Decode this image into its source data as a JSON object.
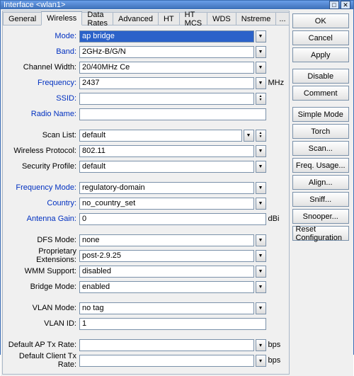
{
  "window": {
    "title": "Interface <wlan1>"
  },
  "tabs": [
    "General",
    "Wireless",
    "Data Rates",
    "Advanced",
    "HT",
    "HT MCS",
    "WDS",
    "Nstreme",
    "..."
  ],
  "active_tab": 1,
  "form": {
    "mode": {
      "label": "Mode:",
      "value": "ap bridge",
      "blue": true,
      "dd": true,
      "sel": true
    },
    "band": {
      "label": "Band:",
      "value": "2GHz-B/G/N",
      "blue": true,
      "dd": true
    },
    "chwidth": {
      "label": "Channel Width:",
      "value": "20/40MHz Ce",
      "blue": false,
      "dd": true
    },
    "freq": {
      "label": "Frequency:",
      "value": "2437",
      "blue": true,
      "dd": true,
      "unit": "MHz"
    },
    "ssid": {
      "label": "SSID:",
      "value": "",
      "blue": true,
      "updown": true
    },
    "radio": {
      "label": "Radio Name:",
      "value": "",
      "blue": true
    },
    "scanlist": {
      "label": "Scan List:",
      "value": "default",
      "blue": false,
      "dd": true,
      "updown": true
    },
    "wproto": {
      "label": "Wireless Protocol:",
      "value": "802.11",
      "blue": false,
      "dd": true
    },
    "secprof": {
      "label": "Security Profile:",
      "value": "default",
      "blue": false,
      "dd": true
    },
    "freqmode": {
      "label": "Frequency Mode:",
      "value": "regulatory-domain",
      "blue": true,
      "dd": true
    },
    "country": {
      "label": "Country:",
      "value": "no_country_set",
      "blue": true,
      "dd": true
    },
    "antgain": {
      "label": "Antenna Gain:",
      "value": "0",
      "blue": true,
      "unit": "dBi"
    },
    "dfs": {
      "label": "DFS Mode:",
      "value": "none",
      "blue": false,
      "dd": true
    },
    "propext": {
      "label": "Proprietary Extensions:",
      "value": "post-2.9.25",
      "blue": false,
      "dd": true
    },
    "wmm": {
      "label": "WMM Support:",
      "value": "disabled",
      "blue": false,
      "dd": true
    },
    "bridge": {
      "label": "Bridge Mode:",
      "value": "enabled",
      "blue": false,
      "dd": true
    },
    "vlanmode": {
      "label": "VLAN Mode:",
      "value": "no tag",
      "blue": false,
      "dd": true
    },
    "vlanid": {
      "label": "VLAN ID:",
      "value": "1",
      "blue": false
    },
    "defap": {
      "label": "Default AP Tx Rate:",
      "value": "",
      "blue": false,
      "dd_solid": true,
      "unit": "bps"
    },
    "defcl": {
      "label": "Default Client Tx Rate:",
      "value": "",
      "blue": false,
      "dd_solid": true,
      "unit": "bps"
    }
  },
  "buttons": {
    "ok": "OK",
    "cancel": "Cancel",
    "apply": "Apply",
    "disable": "Disable",
    "comment": "Comment",
    "simple": "Simple Mode",
    "torch": "Torch",
    "scan": "Scan...",
    "frequsage": "Freq. Usage...",
    "align": "Align...",
    "sniff": "Sniff...",
    "snooper": "Snooper...",
    "reset": "Reset Configuration"
  }
}
